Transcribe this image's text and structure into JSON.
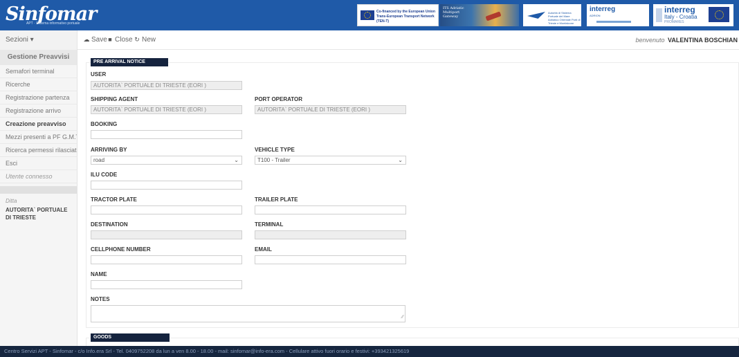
{
  "header": {
    "logo_text": "Sinfomar",
    "logo_tagline": "APT · Sistema informativo portuale",
    "banners": {
      "eu": "Co-financed by the European Union Trans-European Transport Network (TEN-T)",
      "its": "ITS Adriatic Multiport Gateway",
      "autorita": "Autorità di Sistema Portuale del Mare Adriatico Orientale Porti di Trieste e Monfalcone",
      "adrion_name": "interreg",
      "adrion_sub": "ADRION",
      "interreg_name": "interreg",
      "interreg_sub": "Italy - Croatia",
      "interreg_project": "PROMARES"
    }
  },
  "toolbar": {
    "sezioni_label": "Sezioni ▾",
    "save_label": "Save",
    "close_label": "Close",
    "new_label": "New",
    "welcome_prefix": "benvenuto",
    "welcome_user": "VALENTINA BOSCHIAN"
  },
  "sidebar": {
    "title": "Gestione Preavvisi",
    "items": [
      {
        "label": "Semafori terminal"
      },
      {
        "label": "Ricerche"
      },
      {
        "label": "Registrazione partenza"
      },
      {
        "label": "Registrazione arrivo"
      },
      {
        "label": "Creazione preavviso"
      },
      {
        "label": "Mezzi presenti a PF G.M.T."
      },
      {
        "label": "Ricerca permessi rilasciati"
      },
      {
        "label": "Esci"
      }
    ],
    "utente_label": "Utente connesso",
    "ditta_label": "Ditta",
    "ditta_value": "AUTORITA` PORTUALE DI TRIESTE"
  },
  "form": {
    "section_title": "PRE ARRIVAL NOTICE",
    "user": {
      "label": "USER",
      "value": "AUTORITA` PORTUALE DI TRIESTE (EORI )"
    },
    "shipping_agent": {
      "label": "SHIPPING AGENT",
      "value": "AUTORITA` PORTUALE DI TRIESTE (EORI )"
    },
    "port_operator": {
      "label": "PORT OPERATOR",
      "value": "AUTORITA` PORTUALE DI TRIESTE (EORI )"
    },
    "booking": {
      "label": "BOOKING",
      "value": ""
    },
    "arriving_by": {
      "label": "ARRIVING BY",
      "value": "road"
    },
    "vehicle_type": {
      "label": "VEHICLE TYPE",
      "value": "T100 - Trailer"
    },
    "ilu_code": {
      "label": "ILU CODE",
      "value": ""
    },
    "tractor_plate": {
      "label": "TRACTOR PLATE",
      "value": ""
    },
    "trailer_plate": {
      "label": "TRAILER PLATE",
      "value": ""
    },
    "destination": {
      "label": "DESTINATION",
      "value": ""
    },
    "terminal": {
      "label": "TERMINAL",
      "value": ""
    },
    "cellphone": {
      "label": "CELLPHONE NUMBER",
      "value": ""
    },
    "email": {
      "label": "EMAIL",
      "value": ""
    },
    "name": {
      "label": "NAME",
      "value": ""
    },
    "notes": {
      "label": "NOTES",
      "value": ""
    },
    "goods_title": "GOODS"
  },
  "footer": {
    "text": "Centro Servizi APT - Sinfomar - c/o Info.era Srl - Tel. 0409752208 da lun a ven 8.00 - 18.00 - mail: sinfomar@info-era.com - Cellulare attivo fuori orario e festivi: +393421325619"
  }
}
